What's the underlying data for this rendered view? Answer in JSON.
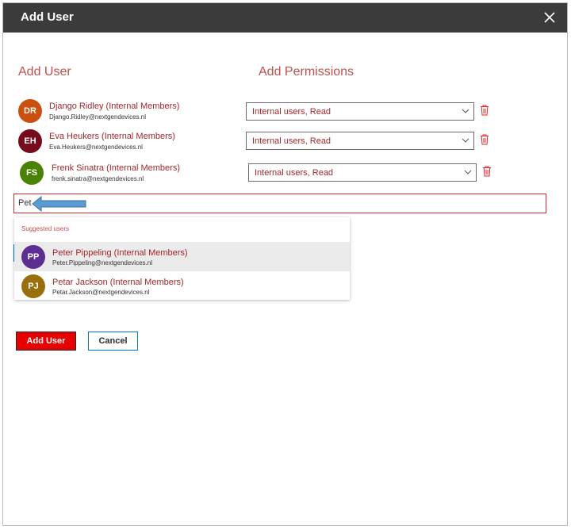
{
  "dialog": {
    "title": "Add User",
    "add_user_heading": "Add User",
    "add_permissions_heading": "Add Permissions"
  },
  "users": [
    {
      "initials": "DR",
      "name": "Django Ridley (Internal Members)",
      "email": "Django.Ridley@nextgendevices.nl",
      "permission": "Internal users, Read",
      "color": "#ca5010"
    },
    {
      "initials": "EH",
      "name": "Eva Heukers (Internal Members)",
      "email": "Eva.Heukers@nextgendevices.nl",
      "permission": "Internal users, Read",
      "color": "#750b1c"
    },
    {
      "initials": "FS",
      "name": "Frenk Sinatra (Internal Members)",
      "email": "frenk.sinatra@nextgendevices.nl",
      "permission": "Internal users, Read",
      "color": "#498205"
    }
  ],
  "search": {
    "value": "Pet"
  },
  "suggestions": {
    "heading": "Suggested users",
    "items": [
      {
        "initials": "PP",
        "name": "Peter Pippeling (Internal Members)",
        "email": "Peter.Pippeling@nextgendevices.nl",
        "color": "#5c2e91"
      },
      {
        "initials": "PJ",
        "name": "Petar Jackson (Internal Members)",
        "email": "Petar.Jackson@nextgendevices.nl",
        "color": "#986f0b"
      }
    ]
  },
  "buttons": {
    "add_label": "Add User",
    "cancel_label": "Cancel"
  },
  "colors": {
    "accent_red": "#e60000",
    "heading_red": "#c0504d",
    "titlebar": "#3b3b3b",
    "focus_blue": "#0078d4"
  },
  "icons": {
    "close": "close-icon",
    "chevron": "chevron-down-icon",
    "delete": "trash-icon",
    "pointer": "arrow-pointer-icon"
  }
}
